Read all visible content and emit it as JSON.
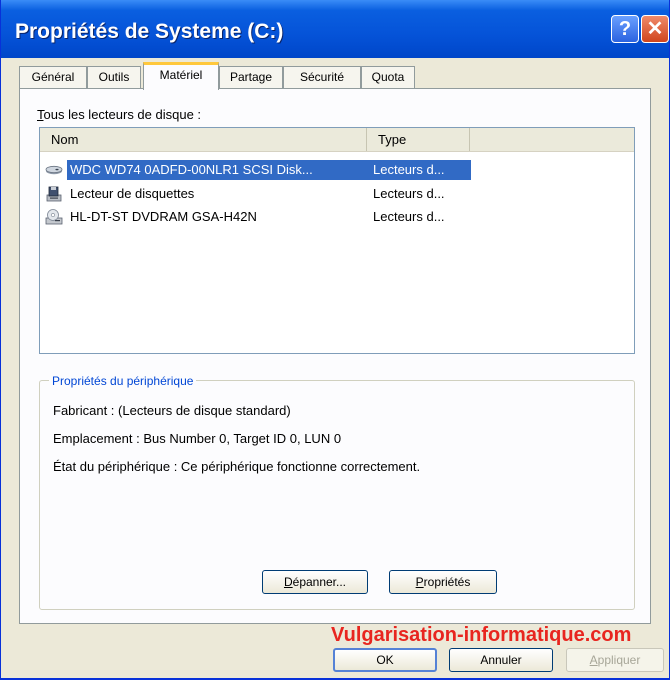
{
  "window": {
    "title": "Propriétés de Systeme (C:)",
    "help_glyph": "?",
    "close_glyph": "✕"
  },
  "tabs": [
    {
      "label": "Général",
      "active": false
    },
    {
      "label": "Outils",
      "active": false
    },
    {
      "label": "Matériel",
      "active": true
    },
    {
      "label": "Partage",
      "active": false
    },
    {
      "label": "Sécurité",
      "active": false
    },
    {
      "label": "Quota",
      "active": false
    }
  ],
  "list": {
    "label_accel": "T",
    "label_rest": "ous les lecteurs de disque :",
    "columns": {
      "name": "Nom",
      "type": "Type"
    },
    "rows": [
      {
        "name": "WDC WD74 0ADFD-00NLR1 SCSI Disk...",
        "type": "Lecteurs d...",
        "icon": "hard-disk-icon",
        "selected": true
      },
      {
        "name": "Lecteur de disquettes",
        "type": "Lecteurs d...",
        "icon": "floppy-drive-icon",
        "selected": false
      },
      {
        "name": "HL-DT-ST DVDRAM GSA-H42N",
        "type": "Lecteurs d...",
        "icon": "optical-drive-icon",
        "selected": false
      }
    ]
  },
  "device_properties": {
    "group_title": "Propriétés du périphérique",
    "manufacturer": "Fabricant : (Lecteurs de disque standard)",
    "location": "Emplacement : Bus Number 0, Target ID 0, LUN 0",
    "status": "État du périphérique : Ce périphérique fonctionne correctement."
  },
  "buttons": {
    "troubleshoot_accel": "D",
    "troubleshoot_rest": "épanner...",
    "properties_accel": "P",
    "properties_rest": "ropriétés",
    "ok": "OK",
    "cancel": "Annuler",
    "apply_accel": "A",
    "apply_rest": "ppliquer"
  },
  "watermark": "Vulgarisation-informatique.com",
  "colors": {
    "selection": "#316ac5",
    "titlebar": "#0553d8",
    "group_title": "#0046d5",
    "watermark": "#e8251f"
  }
}
